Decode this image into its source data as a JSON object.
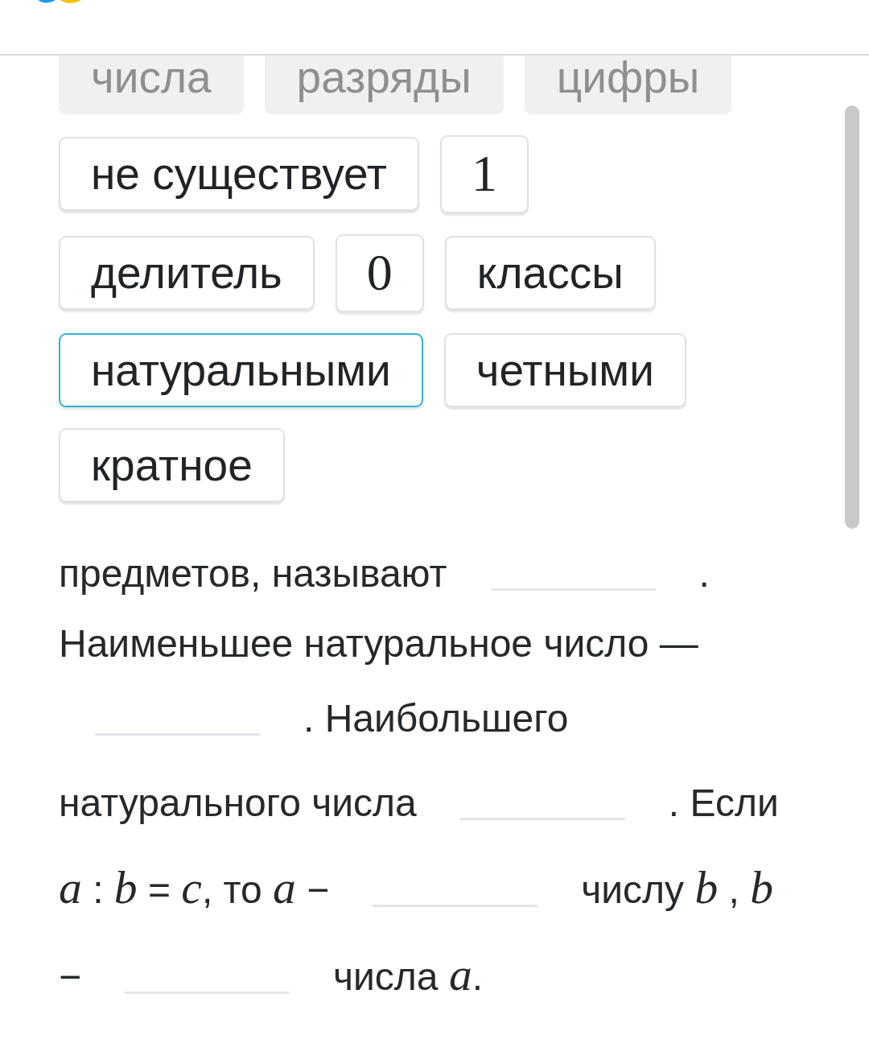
{
  "word_bank": {
    "chips": [
      {
        "text": "числа",
        "kind": "text",
        "disabled": true,
        "selected": false
      },
      {
        "text": "разряды",
        "kind": "text",
        "disabled": true,
        "selected": false
      },
      {
        "text": "цифры",
        "kind": "text",
        "disabled": true,
        "selected": false
      },
      {
        "text": "не существует",
        "kind": "text",
        "disabled": false,
        "selected": false
      },
      {
        "text": "1",
        "kind": "math",
        "disabled": false,
        "selected": false
      },
      {
        "text": "делитель",
        "kind": "text",
        "disabled": false,
        "selected": false
      },
      {
        "text": "0",
        "kind": "math",
        "disabled": false,
        "selected": false
      },
      {
        "text": "классы",
        "kind": "text",
        "disabled": false,
        "selected": false
      },
      {
        "text": "натуральными",
        "kind": "text",
        "disabled": false,
        "selected": true
      },
      {
        "text": "четными",
        "kind": "text",
        "disabled": false,
        "selected": false
      },
      {
        "text": "кратное",
        "kind": "text",
        "disabled": false,
        "selected": false
      }
    ]
  },
  "exercise": {
    "lines": [
      {
        "parts": [
          {
            "kind": "text",
            "text": "предметов, называют"
          },
          {
            "kind": "blank"
          },
          {
            "kind": "text",
            "text": "."
          }
        ]
      },
      {
        "parts": [
          {
            "kind": "text",
            "text": "Наименьшее натуральное число —"
          }
        ]
      },
      {
        "parts": [
          {
            "kind": "blank"
          },
          {
            "kind": "text",
            "text": ". Наибольшего"
          }
        ]
      },
      {
        "parts": [
          {
            "kind": "text",
            "text": "натурального числа"
          },
          {
            "kind": "blank"
          },
          {
            "kind": "text",
            "text": ". Если"
          }
        ]
      },
      {
        "parts": [
          {
            "kind": "text",
            "text": "*a* : *b* = *c*, то *a* −"
          },
          {
            "kind": "blank"
          },
          {
            "kind": "text",
            "text": "числу *b* , *b*"
          }
        ]
      },
      {
        "parts": [
          {
            "kind": "text",
            "text": "−"
          },
          {
            "kind": "blank"
          },
          {
            "kind": "text",
            "text": "числа *a*."
          }
        ]
      }
    ]
  }
}
